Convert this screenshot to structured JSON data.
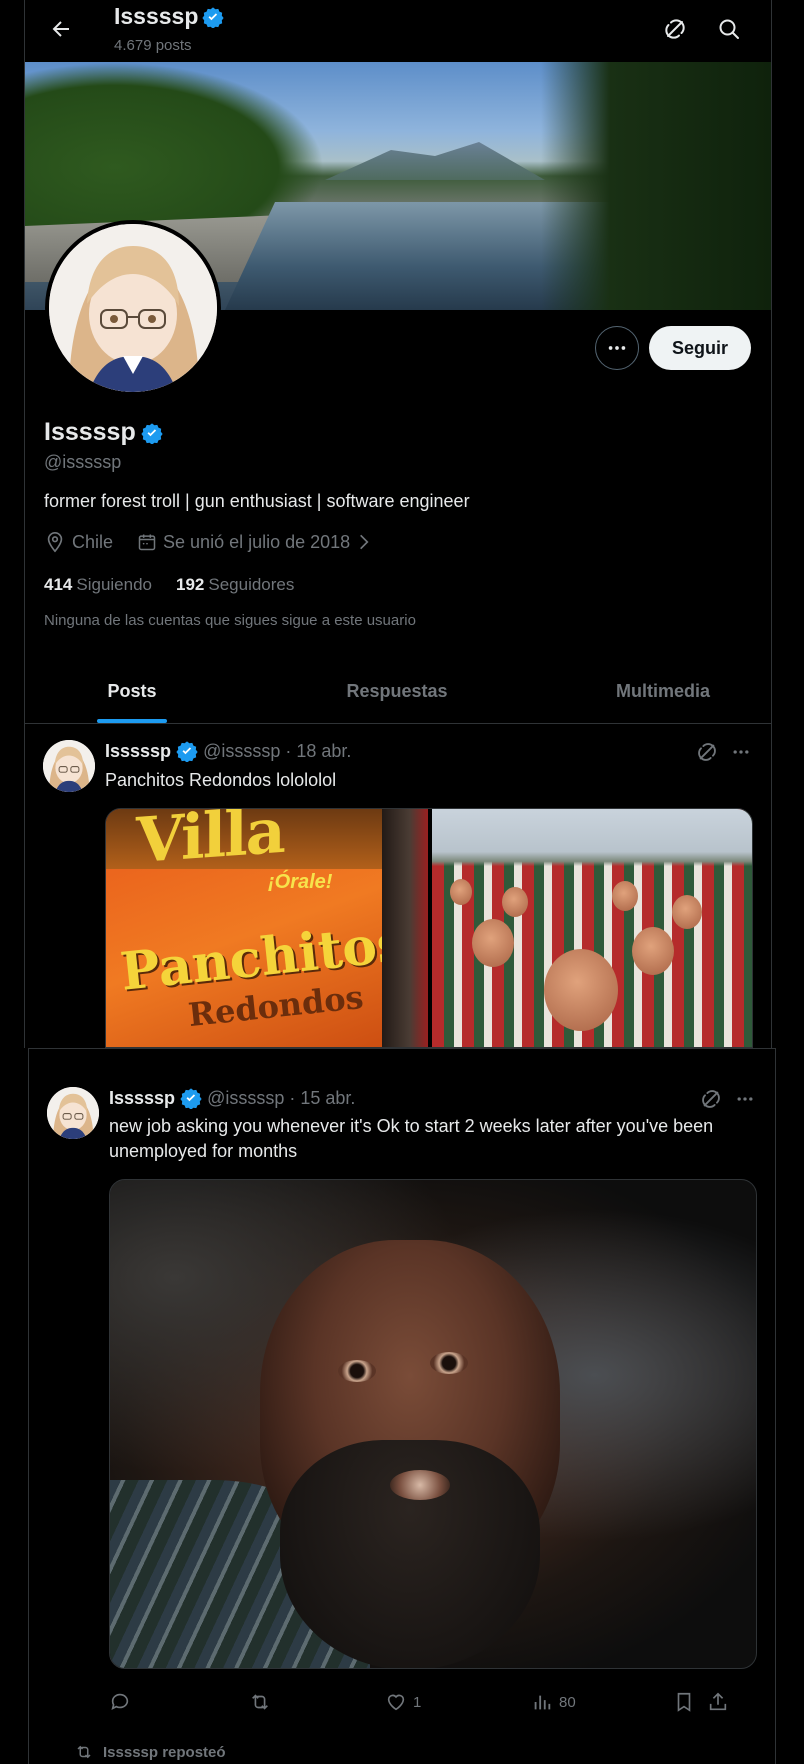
{
  "header": {
    "name": "Isssssp",
    "posts_count": "4.679 posts"
  },
  "profile": {
    "name": "Isssssp",
    "handle": "@isssssp",
    "bio": "former forest troll | gun enthusiast | software engineer",
    "location": "Chile",
    "joined": "Se unió el julio de 2018",
    "following_count": "414",
    "following_label": "Siguiendo",
    "followers_count": "192",
    "followers_label": "Seguidores",
    "note": "Ninguna de las cuentas que sigues sigue a este usuario",
    "follow_label": "Seguir"
  },
  "tabs": [
    {
      "label": "Posts",
      "active": true
    },
    {
      "label": "Respuestas",
      "active": false
    },
    {
      "label": "Multimedia",
      "active": false
    }
  ],
  "posts": [
    {
      "name": "Isssssp",
      "handle": "@isssssp",
      "date": "· 18 abr.",
      "text": "Panchitos Redondos lolololol",
      "media": [
        "chips-bag-photo",
        "crowd-image"
      ]
    },
    {
      "name": "Isssssp",
      "handle": "@isssssp",
      "date": "· 15 abr.",
      "text": "new job asking you whenever it's Ok to start 2 weeks later after you've been unemployed for months",
      "media": [
        "reaction-gif"
      ],
      "likes": "1",
      "views": "80"
    }
  ],
  "chip_bag": {
    "brand": "Villa",
    "tag": "¡Órale!",
    "product_line1": "Panchitos",
    "product_line2": "Redondos"
  },
  "repost_note": "Isssssp reposteó",
  "colors": {
    "accent": "#1d9bf0",
    "background": "#000000",
    "text": "#e7e9ea",
    "muted": "#71767b"
  }
}
